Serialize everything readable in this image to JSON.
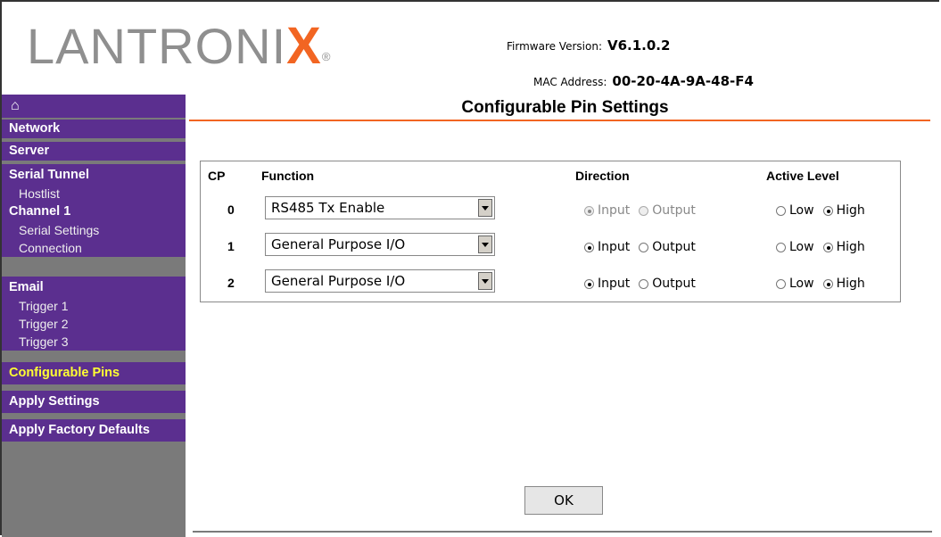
{
  "brand": {
    "logo_part1": "LANTRONI",
    "logo_part2": "X",
    "reg_mark": "®"
  },
  "header": {
    "firmware_label": "Firmware Version:",
    "firmware_value": "V6.1.0.2",
    "mac_label": "MAC Address:",
    "mac_value": "00-20-4A-9A-48-F4"
  },
  "sidebar": {
    "home_icon": "home-icon",
    "items": [
      {
        "label": "Network",
        "type": "head"
      },
      {
        "label": "Server",
        "type": "head"
      },
      {
        "label": "Serial Tunnel",
        "type": "head"
      },
      {
        "label": "Hostlist",
        "type": "sub"
      },
      {
        "label": "Channel 1",
        "type": "head"
      },
      {
        "label": "Serial Settings",
        "type": "sub"
      },
      {
        "label": "Connection",
        "type": "sub"
      },
      {
        "label": "Email",
        "type": "head"
      },
      {
        "label": "Trigger 1",
        "type": "sub"
      },
      {
        "label": "Trigger 2",
        "type": "sub"
      },
      {
        "label": "Trigger 3",
        "type": "sub"
      },
      {
        "label": "Configurable Pins",
        "type": "head",
        "active": true
      },
      {
        "label": "Apply Settings",
        "type": "head"
      },
      {
        "label": "Apply Factory Defaults",
        "type": "head"
      }
    ]
  },
  "page": {
    "title": "Configurable Pin Settings"
  },
  "table": {
    "headers": {
      "cp": "CP",
      "function": "Function",
      "direction": "Direction",
      "active_level": "Active Level"
    },
    "rows": [
      {
        "cp": "0",
        "function": "RS485 Tx Enable",
        "direction": "Input",
        "direction_disabled": true,
        "active_level": "High"
      },
      {
        "cp": "1",
        "function": "General Purpose I/O",
        "direction": "Input",
        "direction_disabled": false,
        "active_level": "High"
      },
      {
        "cp": "2",
        "function": "General Purpose I/O",
        "direction": "Input",
        "direction_disabled": false,
        "active_level": "High"
      }
    ],
    "labels": {
      "input": "Input",
      "output": "Output",
      "low": "Low",
      "high": "High"
    }
  },
  "buttons": {
    "ok": "OK"
  },
  "colors": {
    "accent": "#f26522",
    "nav_bg": "#5b2f8f",
    "nav_active": "#ffff33"
  }
}
